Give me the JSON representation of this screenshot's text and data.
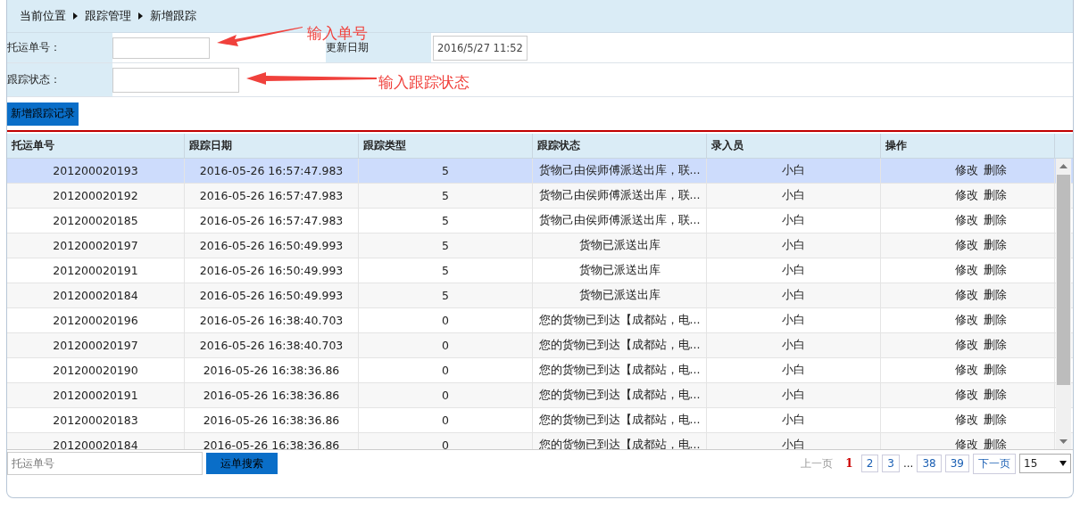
{
  "breadcrumb": [
    "当前位置",
    "跟踪管理",
    "新增跟踪"
  ],
  "form": {
    "waybill_label": "托运单号：",
    "date_label": "更新日期",
    "date_value": "2016/5/27 11:52",
    "status_label": "跟踪状态：",
    "submit": "新增跟踪记录"
  },
  "annotations": [
    {
      "text": "输入单号"
    },
    {
      "text": "输入跟踪状态"
    }
  ],
  "table": {
    "columns": [
      "托运单号",
      "跟踪日期",
      "跟踪类型",
      "跟踪状态",
      "录入员",
      "操作"
    ],
    "rows": [
      {
        "selected": true,
        "cells": [
          "201200020193",
          "2016-05-26 16:57:47.983",
          "5",
          "货物己由侯师傅派送出库，联...",
          "小白"
        ],
        "actions": [
          "修改",
          "删除"
        ]
      },
      {
        "selected": false,
        "cells": [
          "201200020192",
          "2016-05-26 16:57:47.983",
          "5",
          "货物己由侯师傅派送出库，联...",
          "小白"
        ],
        "actions": [
          "修改",
          "删除"
        ]
      },
      {
        "selected": false,
        "cells": [
          "201200020185",
          "2016-05-26 16:57:47.983",
          "5",
          "货物己由侯师傅派送出库，联...",
          "小白"
        ],
        "actions": [
          "修改",
          "删除"
        ]
      },
      {
        "selected": false,
        "cells": [
          "201200020197",
          "2016-05-26 16:50:49.993",
          "5",
          "货物已派送出库",
          "小白"
        ],
        "actions": [
          "修改",
          "删除"
        ]
      },
      {
        "selected": false,
        "cells": [
          "201200020191",
          "2016-05-26 16:50:49.993",
          "5",
          "货物已派送出库",
          "小白"
        ],
        "actions": [
          "修改",
          "删除"
        ]
      },
      {
        "selected": false,
        "cells": [
          "201200020184",
          "2016-05-26 16:50:49.993",
          "5",
          "货物已派送出库",
          "小白"
        ],
        "actions": [
          "修改",
          "删除"
        ]
      },
      {
        "selected": false,
        "cells": [
          "201200020196",
          "2016-05-26 16:38:40.703",
          "0",
          "您的货物已到达【成都站，电...",
          "小白"
        ],
        "actions": [
          "修改",
          "删除"
        ]
      },
      {
        "selected": false,
        "cells": [
          "201200020197",
          "2016-05-26 16:38:40.703",
          "0",
          "您的货物已到达【成都站，电...",
          "小白"
        ],
        "actions": [
          "修改",
          "删除"
        ]
      },
      {
        "selected": false,
        "cells": [
          "201200020190",
          "2016-05-26 16:38:36.86",
          "0",
          "您的货物已到达【成都站，电...",
          "小白"
        ],
        "actions": [
          "修改",
          "删除"
        ]
      },
      {
        "selected": false,
        "cells": [
          "201200020191",
          "2016-05-26 16:38:36.86",
          "0",
          "您的货物已到达【成都站，电...",
          "小白"
        ],
        "actions": [
          "修改",
          "删除"
        ]
      },
      {
        "selected": false,
        "cells": [
          "201200020183",
          "2016-05-26 16:38:36.86",
          "0",
          "您的货物已到达【成都站，电...",
          "小白"
        ],
        "actions": [
          "修改",
          "删除"
        ]
      },
      {
        "selected": false,
        "cells": [
          "201200020184",
          "2016-05-26 16:38:36.86",
          "0",
          "您的货物已到达【成都站，电...",
          "小白"
        ],
        "actions": [
          "修改",
          "删除"
        ]
      }
    ]
  },
  "footer": {
    "search_placeholder": "托运单号",
    "search_button": "运单搜索",
    "pager": [
      {
        "label": "上一页",
        "kind": "prev",
        "disabled": true
      },
      {
        "label": "1",
        "kind": "page",
        "selected": true
      },
      {
        "label": "2",
        "kind": "page",
        "selected": false
      },
      {
        "label": "3",
        "kind": "page",
        "selected": false
      },
      {
        "label": "...",
        "kind": "gap"
      },
      {
        "label": "38",
        "kind": "page",
        "selected": false
      },
      {
        "label": "39",
        "kind": "page",
        "selected": false
      },
      {
        "label": "下一页",
        "kind": "next",
        "disabled": false
      }
    ],
    "page_size": "15"
  }
}
